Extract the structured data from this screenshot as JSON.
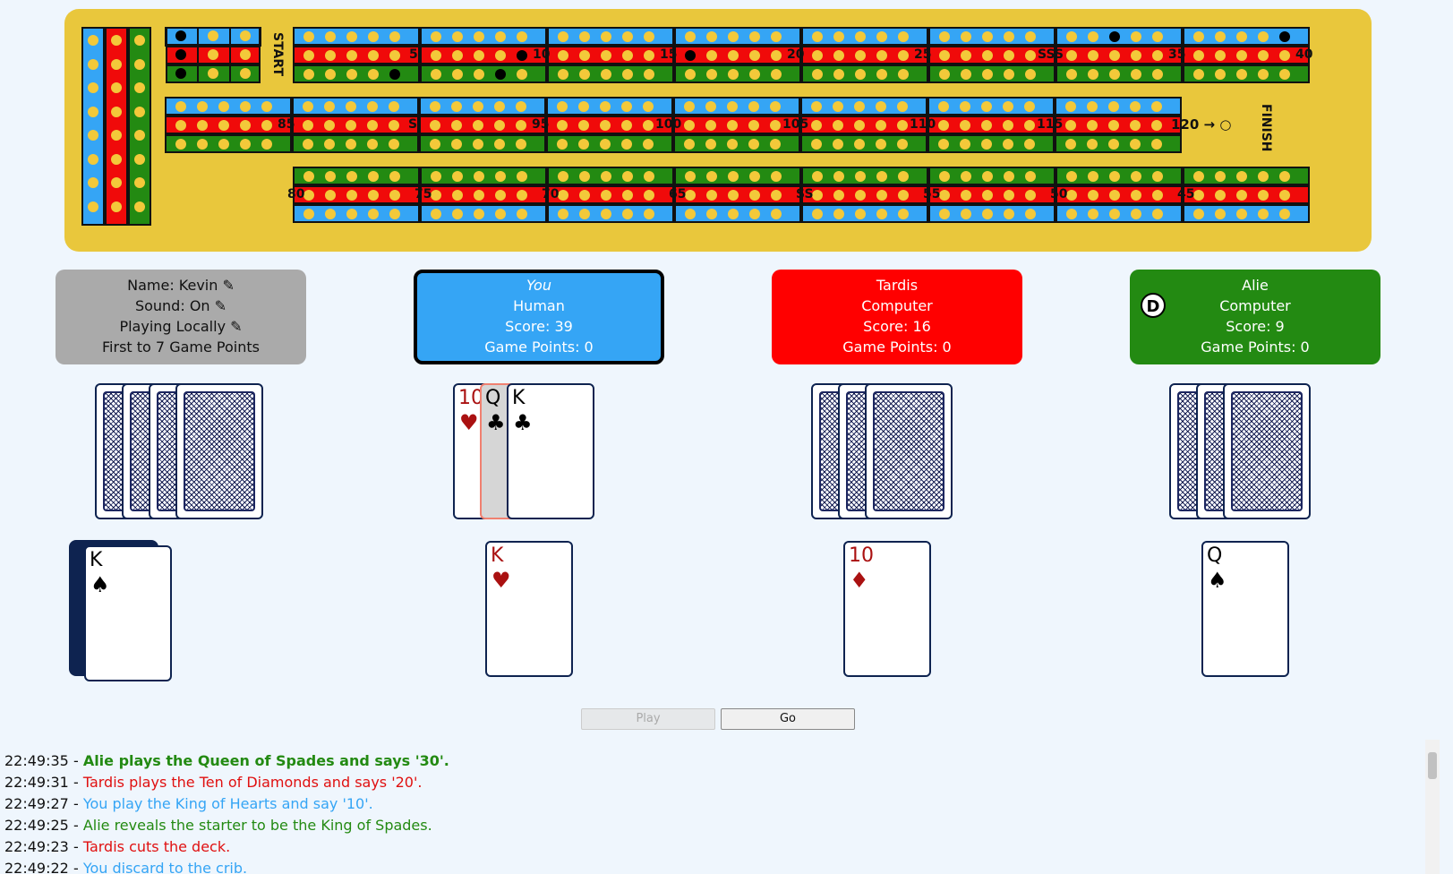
{
  "board": {
    "start_label": "START",
    "finish_label": "FINISH",
    "finish_arrow": "120 → ○",
    "top_labels": [
      "5",
      "10",
      "15",
      "20",
      "25",
      "SSS",
      "35",
      "40"
    ],
    "middle_labels": [
      "85",
      "S",
      "95",
      "100",
      "105",
      "110",
      "115"
    ],
    "bottom_labels": [
      "80",
      "75",
      "70",
      "65",
      "SS",
      "55",
      "50",
      "45"
    ],
    "colors": {
      "blue": "#35a5f5",
      "red": "#f00a0a",
      "green": "#238a12",
      "board": "#e9c73c",
      "hole": "#f3c93a"
    }
  },
  "info_panel": {
    "name": "Name: Kevin",
    "sound": "Sound: On",
    "playing": "Playing Locally",
    "target": "First to 7 Game Points",
    "edit_icon": "pencil-icon"
  },
  "players": [
    {
      "name": "You",
      "type": "Human",
      "score": "Score: 39",
      "game_points": "Game Points: 0",
      "color": "#35a5f5"
    },
    {
      "name": "Tardis",
      "type": "Computer",
      "score": "Score: 16",
      "game_points": "Game Points: 0",
      "color": "#ff0000"
    },
    {
      "name": "Alie",
      "type": "Computer",
      "score": "Score: 9",
      "game_points": "Game Points: 0",
      "color": "#238a12",
      "dealer_badge": "D"
    }
  ],
  "hand": [
    {
      "rank": "10",
      "suit": "♥",
      "color": "#a11"
    },
    {
      "rank": "Q",
      "suit": "♣",
      "color": "#111"
    },
    {
      "rank": "K",
      "suit": "♣",
      "color": "#111"
    }
  ],
  "starter": {
    "rank": "K",
    "suit": "♠",
    "color": "#111"
  },
  "played": [
    {
      "rank": "K",
      "suit": "♥",
      "color": "#a11"
    },
    {
      "rank": "10",
      "suit": "♦",
      "color": "#a11"
    },
    {
      "rank": "Q",
      "suit": "♠",
      "color": "#111"
    }
  ],
  "buttons": {
    "play": "Play",
    "go": "Go"
  },
  "log": [
    {
      "time": "22:49:35 - ",
      "text": "Alie plays the Queen of Spades and says '30'.",
      "color": "#238a12",
      "bold": true
    },
    {
      "time": "22:49:31 - ",
      "text": "Tardis plays the Ten of Diamonds and says '20'.",
      "color": "#e01010",
      "bold": false
    },
    {
      "time": "22:49:27 - ",
      "text": "You play the King of Hearts and say '10'.",
      "color": "#35a5f5",
      "bold": false
    },
    {
      "time": "22:49:25 - ",
      "text": "Alie reveals the starter to be the King of Spades.",
      "color": "#238a12",
      "bold": false
    },
    {
      "time": "22:49:23 - ",
      "text": "Tardis cuts the deck.",
      "color": "#e01010",
      "bold": false
    },
    {
      "time": "22:49:22 - ",
      "text": "You discard to the crib.",
      "color": "#35a5f5",
      "bold": false
    }
  ]
}
